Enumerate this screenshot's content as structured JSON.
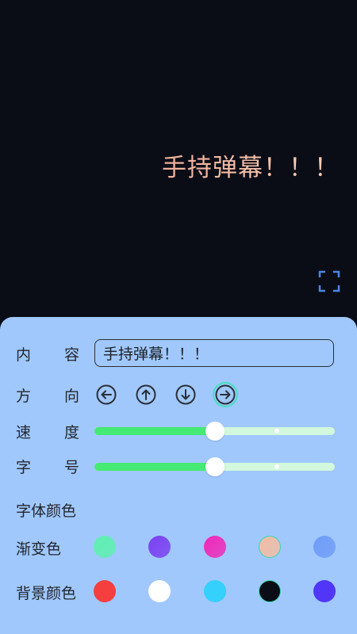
{
  "preview": {
    "text": "手持弹幕！！！",
    "fullscreen_icon": "fullscreen-icon"
  },
  "settings": {
    "content": {
      "label_a": "内",
      "label_b": "容",
      "value": "手持弹幕！！！"
    },
    "direction": {
      "label_a": "方",
      "label_b": "向",
      "options": [
        {
          "icon": "arrow-left-circle-icon"
        },
        {
          "icon": "arrow-up-circle-icon"
        },
        {
          "icon": "arrow-down-circle-icon"
        },
        {
          "icon": "arrow-right-circle-icon"
        }
      ],
      "selected": 3
    },
    "speed": {
      "label_a": "速",
      "label_b": "度",
      "value": 0.5
    },
    "font_size": {
      "label_a": "字",
      "label_b": "号",
      "value": 0.5
    },
    "font_color_label": "字体颜色",
    "gradient": {
      "label": "渐变色",
      "swatches": [
        "#5ef0b0",
        "#7b3ff0",
        "#f028b8",
        "#f3bda4",
        "#6f9cf8"
      ],
      "selected": 3
    },
    "background": {
      "label": "背景颜色",
      "swatches": [
        "#f53e3e",
        "#ffffff",
        "#35d0fb",
        "#0a0d16",
        "#5136f8"
      ],
      "selected": 3
    }
  },
  "colors": {
    "preview_bg": "#0a0d16",
    "panel_bg": "#a0c8fc",
    "slider_fill": "#44ea72",
    "slider_track": "#d2f8dd",
    "accent": "#35d9b0",
    "fullscreen_icon": "#4b86e2"
  }
}
